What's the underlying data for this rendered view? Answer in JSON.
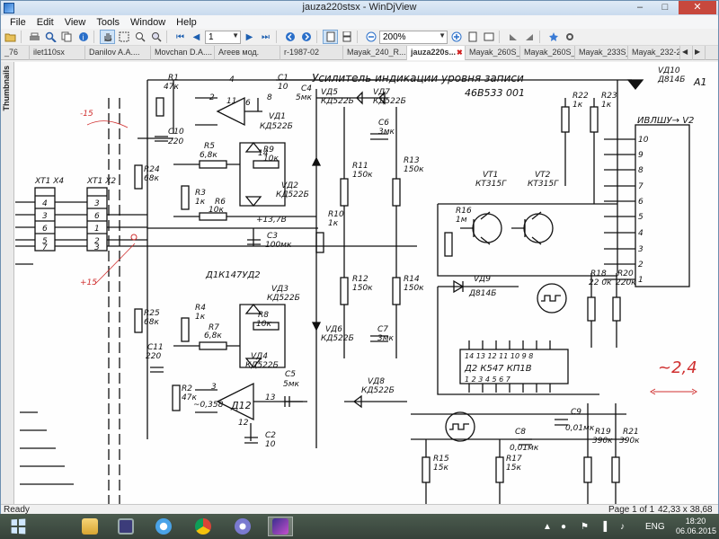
{
  "window": {
    "title": "jauza220stsx - WinDjView",
    "controls": {
      "minimize": "–",
      "maximize": "□",
      "close": "✕"
    }
  },
  "menu": [
    "File",
    "Edit",
    "View",
    "Tools",
    "Window",
    "Help"
  ],
  "toolbar": {
    "page_value": "1",
    "zoom_value": "200%"
  },
  "tabs": [
    {
      "label": "_76"
    },
    {
      "label": "ilet110sx"
    },
    {
      "label": "Danilov A.A...."
    },
    {
      "label": "Movchan D.A...."
    },
    {
      "label": "Агеев мод."
    },
    {
      "label": "r-1987-02"
    },
    {
      "label": "Mayak_240_R..."
    },
    {
      "label": "jauza220s...",
      "active": true
    },
    {
      "label": "Mayak_260S_..."
    },
    {
      "label": "Mayak_260S_..."
    },
    {
      "label": "Mayak_233S_..."
    },
    {
      "label": "Mayak_232-2..."
    }
  ],
  "thumbnails_label": "Thumbnails",
  "schematic": {
    "title_line1": "Усилитель индикации уровня записи",
    "title_line2": "46B533 001",
    "annotations": {
      "left_top": "-15",
      "left_bottom": "+15",
      "right_value": "~2,4",
      "right_arrow": "⟷"
    },
    "labels": {
      "xt1x4": "XT1 X4",
      "xt1x2": "XT1 X2",
      "a1": "A1",
      "ivlsh": "ИВЛШУ→ V2",
      "vd10": "VД10",
      "d814b_top": "Д814Б",
      "d1": "Д1К147УД2",
      "d2": "Д2 К547 КП1В",
      "r1": "R1",
      "r1v": "47к",
      "c1": "C1",
      "c1v": "10",
      "c4": "C4",
      "c4v": "5мк",
      "vd5": "VД5",
      "vd5t": "КД522Б",
      "vd7": "VД7",
      "vd7t": "КД522Б",
      "r22": "R22",
      "r22v": "1к",
      "r23": "R23",
      "r23v": "1к",
      "vd1": "VД1",
      "vd1t": "КД522Б",
      "c10": "C10",
      "c10v": "220",
      "r5": "R5",
      "r5v": "6,8к",
      "r9": "R9",
      "r9v": "10к",
      "c6": "C6",
      "c6v": "3мк",
      "r13": "R13",
      "r13v": "150к",
      "r11": "R11",
      "r11v": "150к",
      "r24": "R24",
      "r24v": "68к",
      "vd2": "VД2",
      "vd2t": "КД522Б",
      "vt1": "VT1",
      "vt1t": "КТ315Г",
      "vt2": "VT2",
      "vt2t": "КТ315Г",
      "r3": "R3",
      "r3v": "1к",
      "r6": "R6",
      "r6v": "10к",
      "r16": "R16",
      "r16v": "1м",
      "v137": "+13,7В",
      "r10": "R10",
      "r10v": "1к",
      "c3": "C3",
      "c3v": "100мк",
      "vd9": "VД9",
      "vd9t": "Д814Б",
      "r18": "R18",
      "r18v": "22 0к",
      "r20": "R20",
      "r20v": "220к",
      "vd3": "VД3",
      "vd3t": "КД522Б",
      "r12": "R12",
      "r12v": "150к",
      "r14": "R14",
      "r14v": "150к",
      "r25": "R25",
      "r25v": "68к",
      "r4": "R4",
      "r4v": "1к",
      "r7": "R7",
      "r7v": "6,8к",
      "r8": "R8",
      "r8v": "10к",
      "vd4": "VД4",
      "vd4t": "КД522Б",
      "vd6": "VД6",
      "vd6t": "КД522Б",
      "c7": "C7",
      "c7v": "3мк",
      "c11": "C11",
      "c11v": "220",
      "r2": "R2",
      "r2v": "47к",
      "c5": "C5",
      "c5v": "5мк",
      "vd8": "VД8",
      "vd8t": "КД522Б",
      "a12": "Д12",
      "v358": "~0,358",
      "c2": "C2",
      "c2v": "10",
      "c9": "C9",
      "c9v": "0,01мк",
      "c8": "C8",
      "c8v": "0,01мк",
      "r15": "R15",
      "r15v": "15к",
      "r17": "R17",
      "r17v": "15к",
      "r19": "R19",
      "r19v": "390к",
      "r21": "R21",
      "r21v": "390к"
    },
    "connector_pins_left": [
      "4",
      "3",
      "6",
      "5",
      "7"
    ],
    "connector_pins_mid": [
      "3",
      "6",
      "1",
      "2",
      "3"
    ],
    "a1_pins": [
      "10",
      "9",
      "8",
      "7",
      "6",
      "5",
      "4",
      "3",
      "2",
      "1"
    ],
    "d2_top_pins": "14 13 12 11 10 9 8",
    "d2_bot_pins": "1 2 3 4 5 6 7",
    "pin_numbers": {
      "p4": "4",
      "p8": "8",
      "p6": "6",
      "p2": "2",
      "p3": "3",
      "p11": "11",
      "p13": "13",
      "p12": "12",
      "p14": "14"
    }
  },
  "status": {
    "left": "Ready",
    "page": "Page 1 of 1",
    "size": "42,33 x 38,68 cm"
  },
  "taskbar": {
    "lang": "ENG",
    "time": "18:20",
    "date": "06.06.2015"
  }
}
